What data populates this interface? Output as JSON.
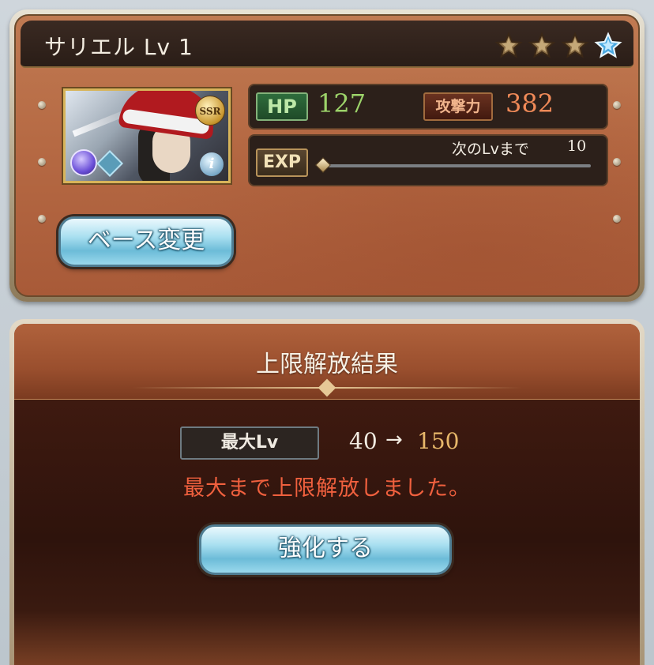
{
  "character": {
    "name_level": "サリエル Lv 1",
    "stars": [
      {
        "state": "bronze"
      },
      {
        "state": "bronze"
      },
      {
        "state": "bronze"
      },
      {
        "state": "blue"
      }
    ],
    "rarity_badge": "SSR",
    "info_badge": "i",
    "stats": {
      "hp_label": "HP",
      "hp_value": "127",
      "atk_label": "攻撃力",
      "atk_value": "382"
    },
    "exp": {
      "label": "EXP",
      "next_label": "次のLvまで",
      "next_value": "10",
      "progress": 0
    },
    "base_change_button": "ベース変更"
  },
  "result": {
    "title": "上限解放結果",
    "max_lv_label": "最大Lv",
    "lv_from": "40",
    "arrow": "→",
    "lv_to": "150",
    "message": "最大まで上限解放しました。",
    "enhance_button": "強化する"
  },
  "colors": {
    "hp_value": "#9dd46a",
    "atk_value": "#f08a58",
    "lv_to": "#e8b86a",
    "message": "#f0603e"
  }
}
